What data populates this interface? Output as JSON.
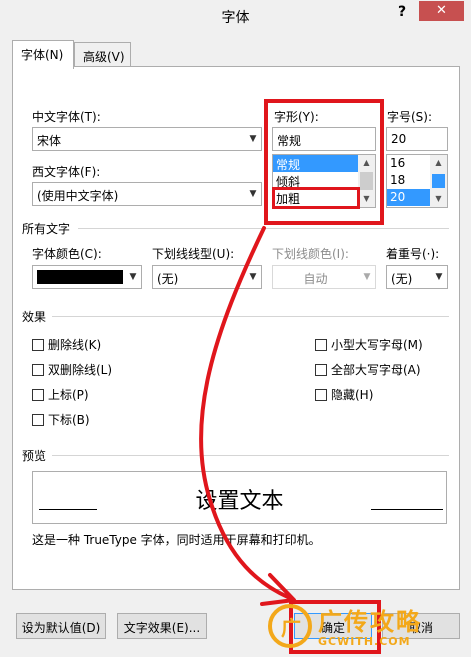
{
  "window": {
    "title": "字体",
    "help": "?",
    "close": "✕"
  },
  "tabs": [
    {
      "label": "字体(N)"
    },
    {
      "label": "高级(V)"
    }
  ],
  "font": {
    "chinese_label": "中文字体(T):",
    "chinese_value": "宋体",
    "western_label": "西文字体(F):",
    "western_value": "(使用中文字体)",
    "style_label": "字形(Y):",
    "style_value": "常规",
    "style_options": [
      "常规",
      "倾斜",
      "加粗"
    ],
    "style_selected": "常规",
    "size_label": "字号(S):",
    "size_value": "20",
    "size_options": [
      "16",
      "18",
      "20"
    ],
    "size_selected": "20"
  },
  "all_text": {
    "section": "所有文字",
    "color_label": "字体颜色(C):",
    "color_value": "#000000",
    "underline_label": "下划线线型(U):",
    "underline_value": "(无)",
    "underline_color_label": "下划线颜色(I):",
    "underline_color_value": "自动",
    "emphasis_label": "着重号(·):",
    "emphasis_value": "(无)"
  },
  "effects": {
    "section": "效果",
    "items_left": [
      "删除线(K)",
      "双删除线(L)",
      "上标(P)",
      "下标(B)"
    ],
    "items_right": [
      "小型大写字母(M)",
      "全部大写字母(A)",
      "隐藏(H)"
    ]
  },
  "preview": {
    "section": "预览",
    "sample": "设置文本",
    "note": "这是一种 TrueType 字体，同时适用于屏幕和打印机。"
  },
  "buttons": {
    "set_default": "设为默认值(D)",
    "text_effects": "文字效果(E)...",
    "ok": "确定",
    "cancel": "取消"
  },
  "watermark": {
    "cn": "广传攻略",
    "en": "GCWITH.COM"
  },
  "colors": {
    "highlight": "#e0161c",
    "selection": "#3399ff",
    "watermark": "#f3a81a"
  }
}
